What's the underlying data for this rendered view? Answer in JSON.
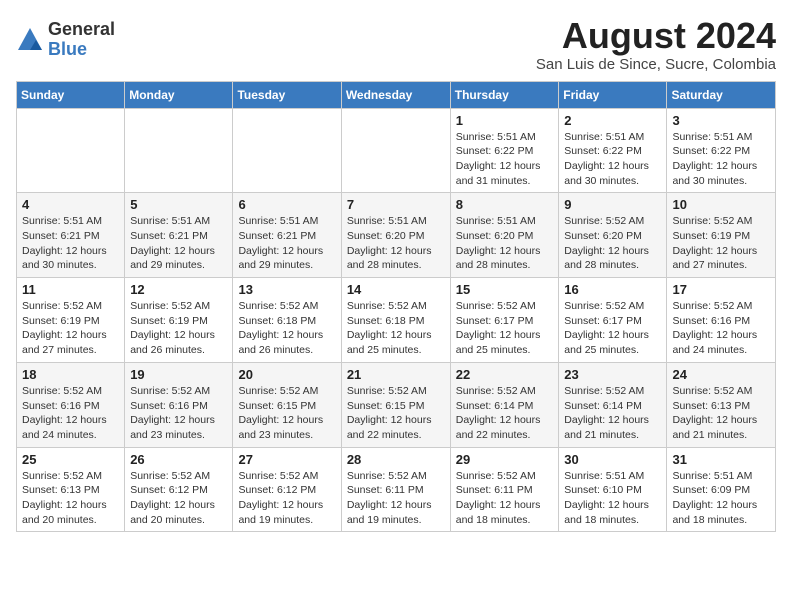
{
  "logo": {
    "general": "General",
    "blue": "Blue"
  },
  "title": {
    "month_year": "August 2024",
    "location": "San Luis de Since, Sucre, Colombia"
  },
  "headers": [
    "Sunday",
    "Monday",
    "Tuesday",
    "Wednesday",
    "Thursday",
    "Friday",
    "Saturday"
  ],
  "weeks": [
    [
      {
        "day": "",
        "info": ""
      },
      {
        "day": "",
        "info": ""
      },
      {
        "day": "",
        "info": ""
      },
      {
        "day": "",
        "info": ""
      },
      {
        "day": "1",
        "info": "Sunrise: 5:51 AM\nSunset: 6:22 PM\nDaylight: 12 hours\nand 31 minutes."
      },
      {
        "day": "2",
        "info": "Sunrise: 5:51 AM\nSunset: 6:22 PM\nDaylight: 12 hours\nand 30 minutes."
      },
      {
        "day": "3",
        "info": "Sunrise: 5:51 AM\nSunset: 6:22 PM\nDaylight: 12 hours\nand 30 minutes."
      }
    ],
    [
      {
        "day": "4",
        "info": "Sunrise: 5:51 AM\nSunset: 6:21 PM\nDaylight: 12 hours\nand 30 minutes."
      },
      {
        "day": "5",
        "info": "Sunrise: 5:51 AM\nSunset: 6:21 PM\nDaylight: 12 hours\nand 29 minutes."
      },
      {
        "day": "6",
        "info": "Sunrise: 5:51 AM\nSunset: 6:21 PM\nDaylight: 12 hours\nand 29 minutes."
      },
      {
        "day": "7",
        "info": "Sunrise: 5:51 AM\nSunset: 6:20 PM\nDaylight: 12 hours\nand 28 minutes."
      },
      {
        "day": "8",
        "info": "Sunrise: 5:51 AM\nSunset: 6:20 PM\nDaylight: 12 hours\nand 28 minutes."
      },
      {
        "day": "9",
        "info": "Sunrise: 5:52 AM\nSunset: 6:20 PM\nDaylight: 12 hours\nand 28 minutes."
      },
      {
        "day": "10",
        "info": "Sunrise: 5:52 AM\nSunset: 6:19 PM\nDaylight: 12 hours\nand 27 minutes."
      }
    ],
    [
      {
        "day": "11",
        "info": "Sunrise: 5:52 AM\nSunset: 6:19 PM\nDaylight: 12 hours\nand 27 minutes."
      },
      {
        "day": "12",
        "info": "Sunrise: 5:52 AM\nSunset: 6:19 PM\nDaylight: 12 hours\nand 26 minutes."
      },
      {
        "day": "13",
        "info": "Sunrise: 5:52 AM\nSunset: 6:18 PM\nDaylight: 12 hours\nand 26 minutes."
      },
      {
        "day": "14",
        "info": "Sunrise: 5:52 AM\nSunset: 6:18 PM\nDaylight: 12 hours\nand 25 minutes."
      },
      {
        "day": "15",
        "info": "Sunrise: 5:52 AM\nSunset: 6:17 PM\nDaylight: 12 hours\nand 25 minutes."
      },
      {
        "day": "16",
        "info": "Sunrise: 5:52 AM\nSunset: 6:17 PM\nDaylight: 12 hours\nand 25 minutes."
      },
      {
        "day": "17",
        "info": "Sunrise: 5:52 AM\nSunset: 6:16 PM\nDaylight: 12 hours\nand 24 minutes."
      }
    ],
    [
      {
        "day": "18",
        "info": "Sunrise: 5:52 AM\nSunset: 6:16 PM\nDaylight: 12 hours\nand 24 minutes."
      },
      {
        "day": "19",
        "info": "Sunrise: 5:52 AM\nSunset: 6:16 PM\nDaylight: 12 hours\nand 23 minutes."
      },
      {
        "day": "20",
        "info": "Sunrise: 5:52 AM\nSunset: 6:15 PM\nDaylight: 12 hours\nand 23 minutes."
      },
      {
        "day": "21",
        "info": "Sunrise: 5:52 AM\nSunset: 6:15 PM\nDaylight: 12 hours\nand 22 minutes."
      },
      {
        "day": "22",
        "info": "Sunrise: 5:52 AM\nSunset: 6:14 PM\nDaylight: 12 hours\nand 22 minutes."
      },
      {
        "day": "23",
        "info": "Sunrise: 5:52 AM\nSunset: 6:14 PM\nDaylight: 12 hours\nand 21 minutes."
      },
      {
        "day": "24",
        "info": "Sunrise: 5:52 AM\nSunset: 6:13 PM\nDaylight: 12 hours\nand 21 minutes."
      }
    ],
    [
      {
        "day": "25",
        "info": "Sunrise: 5:52 AM\nSunset: 6:13 PM\nDaylight: 12 hours\nand 20 minutes."
      },
      {
        "day": "26",
        "info": "Sunrise: 5:52 AM\nSunset: 6:12 PM\nDaylight: 12 hours\nand 20 minutes."
      },
      {
        "day": "27",
        "info": "Sunrise: 5:52 AM\nSunset: 6:12 PM\nDaylight: 12 hours\nand 19 minutes."
      },
      {
        "day": "28",
        "info": "Sunrise: 5:52 AM\nSunset: 6:11 PM\nDaylight: 12 hours\nand 19 minutes."
      },
      {
        "day": "29",
        "info": "Sunrise: 5:52 AM\nSunset: 6:11 PM\nDaylight: 12 hours\nand 18 minutes."
      },
      {
        "day": "30",
        "info": "Sunrise: 5:51 AM\nSunset: 6:10 PM\nDaylight: 12 hours\nand 18 minutes."
      },
      {
        "day": "31",
        "info": "Sunrise: 5:51 AM\nSunset: 6:09 PM\nDaylight: 12 hours\nand 18 minutes."
      }
    ]
  ]
}
